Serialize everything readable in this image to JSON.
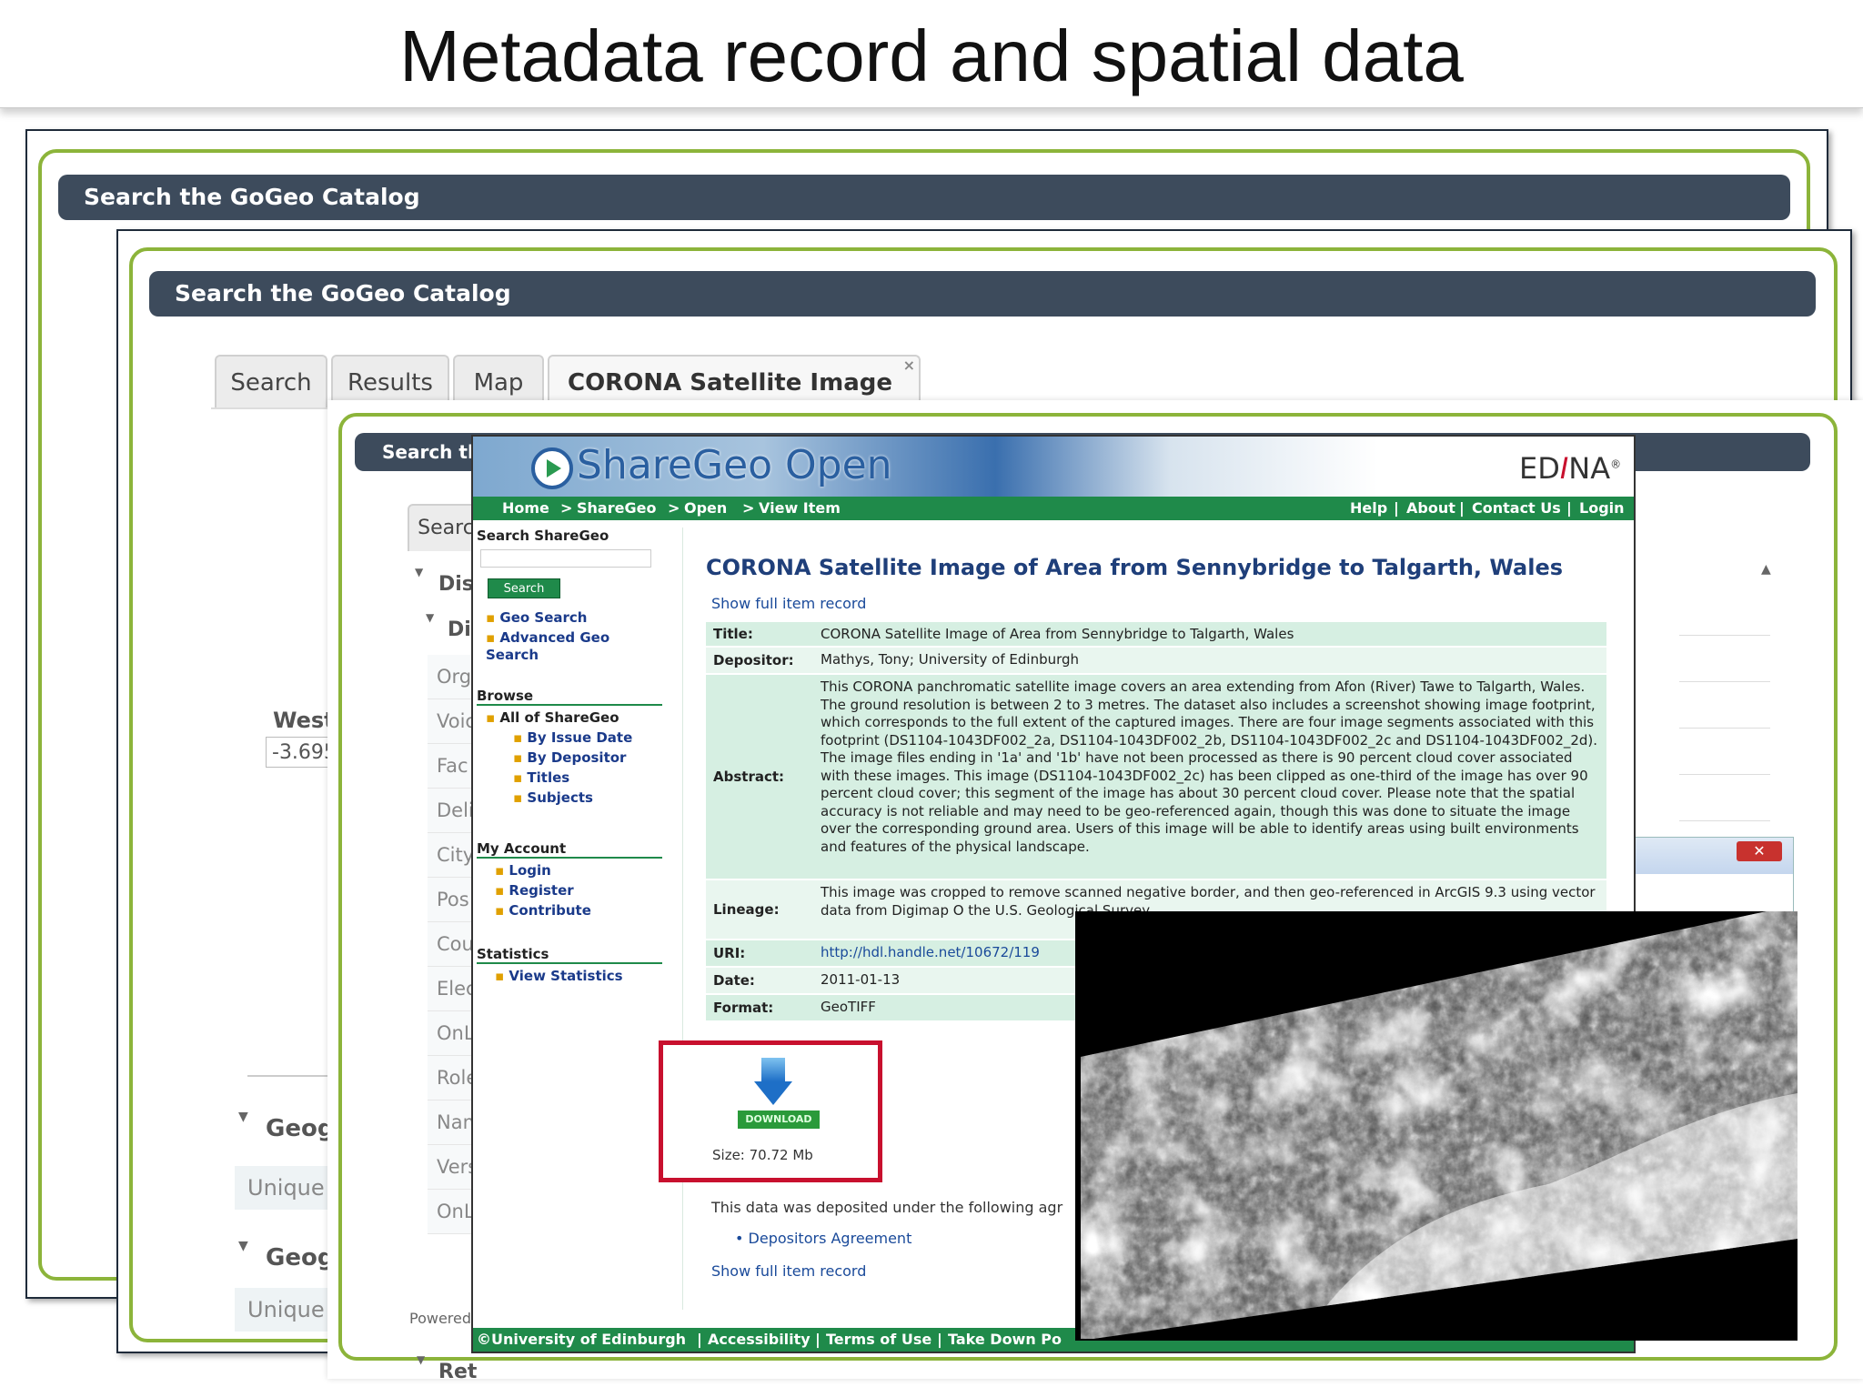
{
  "slide_title": "Metadata record and spatial data",
  "catalog_back": {
    "header": "Search the GoGeo Catalog"
  },
  "catalog_mid": {
    "header": "Search the GoGeo Catalog",
    "tabs": [
      {
        "label": "Search"
      },
      {
        "label": "Results"
      },
      {
        "label": "Map"
      },
      {
        "label": "CORONA Satellite Image o..."
      }
    ],
    "west_label": "West",
    "west_value": "-3.695",
    "geo_heading_1": "Geogr",
    "unique_1": "Unique r",
    "geo_heading_2": "Geogr",
    "unique_2": "Unique r"
  },
  "catalog_front": {
    "header": "Search th",
    "tab_search": "Searc",
    "dis_1": "Dis",
    "dis_2": "Di",
    "fields": [
      "Orga",
      "Voic",
      "Fac",
      "Deliv",
      "City",
      "Pos",
      "Cou",
      "Elec",
      "OnL",
      "Role",
      "Nam",
      "Vers",
      "OnL"
    ],
    "ret": "Ret",
    "powered": "Powered"
  },
  "sharegeo": {
    "logo": "ShareGeo Open",
    "edina_pre": "ED",
    "edina_i": "I",
    "edina_post": "NA",
    "edina_reg": "®",
    "breadcrumb": [
      "Home",
      "ShareGeo",
      "Open",
      "View Item"
    ],
    "top_links": [
      "Help",
      "About",
      "Contact Us",
      "Login"
    ],
    "sidebar": {
      "search_heading": "Search ShareGeo",
      "search_button": "Search",
      "search_links": [
        "Geo Search",
        "Advanced Geo Search"
      ],
      "browse_heading": "Browse",
      "browse_all": "All of ShareGeo",
      "browse_links": [
        "By Issue Date",
        "By Depositor",
        "Titles",
        "Subjects"
      ],
      "account_heading": "My Account",
      "account_links": [
        "Login",
        "Register",
        "Contribute"
      ],
      "stats_heading": "Statistics",
      "stats_link": "View Statistics"
    },
    "item_title": "CORONA Satellite Image of Area from Sennybridge to Talgarth, Wales",
    "show_full": "Show full item record",
    "meta": [
      {
        "key": "Title:",
        "value": "CORONA Satellite Image of Area from Sennybridge to Talgarth, Wales"
      },
      {
        "key": "Depositor:",
        "value": "Mathys, Tony; University of Edinburgh"
      },
      {
        "key": "Abstract:",
        "value": "This CORONA panchromatic satellite image covers an area extending from Afon (River) Tawe to Talgarth, Wales. The ground resolution is between 2 to 3 metres. The dataset also includes a screenshot showing image footprint, which corresponds to the full extent of the captured images. There are four image segments associated with this footprint (DS1104-1043DF002_2a, DS1104-1043DF002_2b, DS1104-1043DF002_2c and DS1104-1043DF002_2d). The image files ending in '1a' and '1b' have not been processed as there is 90 percent cloud cover associated with these images. This image (DS1104-1043DF002_2c) has been clipped as one-third of the image has over 90 percent cloud cover; this segment of the image has about 30 percent cloud cover. Please note that the spatial accuracy is not reliable and may need to be geo-referenced again, though this was done to situate the image over the corresponding ground area. Users of this image will be able to identify areas using built environments and features of the physical landscape."
      },
      {
        "key": "Lineage:",
        "value": "This image was cropped to remove scanned negative border, and then geo-referenced in ArcGIS 9.3 using vector data from Digimap O the U.S. Geological Survey."
      },
      {
        "key": "URI:",
        "value": "http://hdl.handle.net/10672/119"
      },
      {
        "key": "Date:",
        "value": "2011-01-13"
      },
      {
        "key": "Format:",
        "value": "GeoTIFF"
      }
    ],
    "download_label": "DOWNLOAD",
    "size_text": "Size: 70.72 Mb",
    "deposited_text": "This data was deposited under the following agr",
    "agreement_link": "Depositors Agreement",
    "show_full_2": "Show full item record",
    "footer_links": [
      "©University of Edinburgh",
      "Accessibility",
      "Terms of Use",
      "Take Down Po"
    ]
  },
  "colors": {
    "frame_green": "#8cb43a",
    "header_bar": "#3d4b5c",
    "sharegeo_green": "#1f8a4a",
    "highlight_red": "#c8102e"
  }
}
